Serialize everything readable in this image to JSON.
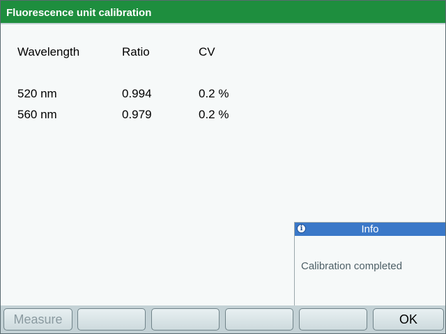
{
  "window": {
    "title": "Fluorescence unit calibration"
  },
  "table": {
    "headers": [
      "Wavelength",
      "Ratio",
      "CV"
    ],
    "rows": [
      [
        "520 nm",
        "0.994",
        "0.2 %"
      ],
      [
        "560 nm",
        "0.979",
        "0.2 %"
      ]
    ]
  },
  "info": {
    "icon": "info-icon",
    "icon_glyph": "i",
    "title": "Info",
    "message": "Calibration completed"
  },
  "softkeys": [
    {
      "label": "Measure",
      "enabled": false
    },
    {
      "label": "",
      "enabled": false
    },
    {
      "label": "",
      "enabled": false
    },
    {
      "label": "",
      "enabled": false
    },
    {
      "label": "",
      "enabled": false
    },
    {
      "label": "OK",
      "enabled": true
    }
  ],
  "colors": {
    "title_bar": "#1e8e3e",
    "info_header": "#3a78c8",
    "footer": "#c4d2d6"
  }
}
